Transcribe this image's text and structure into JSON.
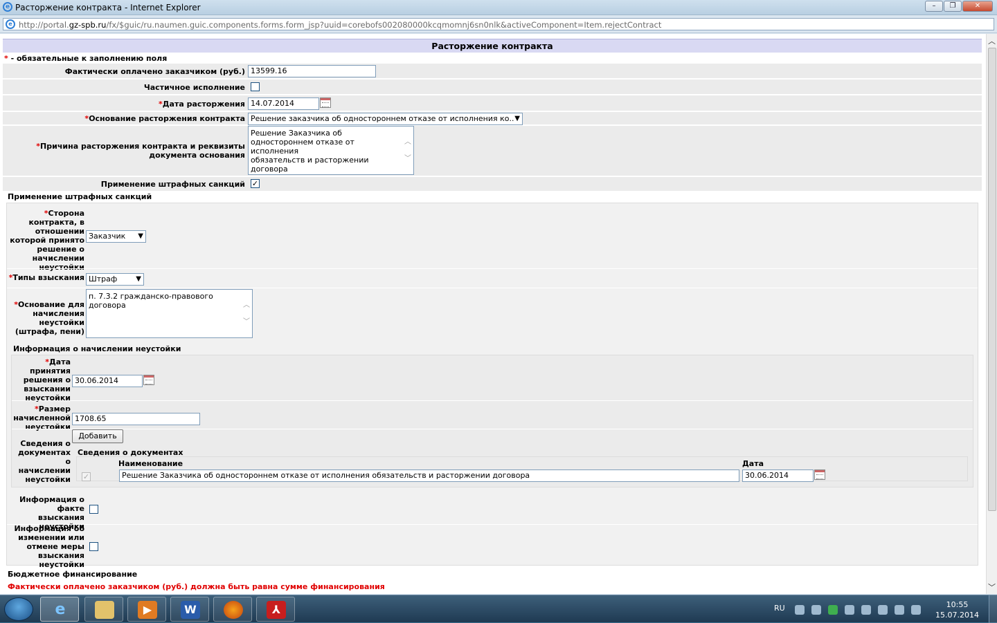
{
  "window": {
    "title": "Расторжение контракта - Internet Explorer",
    "url_prefix": "http://portal.",
    "url_host": "gz-spb.ru",
    "url_rest": "/fx/$guic/ru.naumen.guic.components.forms.form_jsp?uuid=corebofs002080000kcqmomnj6sn0nlk&activeComponent=Item.rejectContract"
  },
  "form": {
    "header": "Расторжение контракта",
    "required_note": " - обязательные к заполнению поля",
    "required_mark": "*",
    "fields": {
      "paid_label": "Фактически оплачено заказчиком (руб.)",
      "paid_value": "13599.16",
      "partial_label": "Частичное исполнение",
      "partial_checked": false,
      "date_label": "Дата расторжения",
      "date_value": "14.07.2014",
      "basis_label": "Основание расторжения контракта",
      "basis_value": "Решение заказчика об одностороннем отказе от исполнения ко..",
      "reason_label": "Причина расторжения контракта и реквизиты документа основания",
      "reason_value": "Решение Заказчика об\nодностороннем отказе от исполнения\nобязательств и расторжении договора",
      "penalty_label": "Применение штрафных санкций",
      "penalty_checked": true
    }
  },
  "penalties": {
    "section_title": "Применение штрафных санкций",
    "party_label": "Сторона контракта, в отношении которой принято решение о начислении неустойки",
    "party_value": "Заказчик",
    "types_label": "Типы взыскания",
    "types_value": "Штраф",
    "basis_label": "Основание для начисления неустойки (штрафа, пени)",
    "basis_value": "п. 7.3.2 гражданско-правового\nдоговора",
    "info_title": "Информация о начислении неустойки",
    "decision_date_label": "Дата принятия решения о взыскании неустойки",
    "decision_date_value": "30.06.2014",
    "amount_label": "Размер начисленной неустойки",
    "amount_value": "1708.65",
    "docs_label": "Сведения о документах о начислении неустойки",
    "add_button": "Добавить",
    "docs_title": "Сведения о документах",
    "docs_col_name": "Наименование",
    "docs_col_date": "Дата",
    "docs_rows": [
      {
        "name": "Решение Заказчика об одностороннем отказе от исполнения обязательств и расторжении договора",
        "date": "30.06.2014",
        "checked": true
      }
    ],
    "fact_label": "Информация о факте взыскания неустойки",
    "fact_checked": false,
    "change_label": "Информация об изменении или отмене меры взыскания неустойки",
    "change_checked": false
  },
  "budget": {
    "section_title": "Бюджетное финансирование",
    "error": "Фактически оплачено заказчиком (руб.) должна быть равна сумме финансирования"
  },
  "taskbar": {
    "lang": "RU",
    "time": "10:55",
    "date": "15.07.2014",
    "apps": [
      "start-button",
      "internet-explorer-icon",
      "file-explorer-icon",
      "media-player-icon",
      "word-icon",
      "firefox-icon",
      "acrobat-icon"
    ]
  },
  "colors": {
    "header_bg": "#d9d9f3",
    "row_bg": "#ebebeb",
    "required": "#e00000",
    "error": "#e00000"
  }
}
